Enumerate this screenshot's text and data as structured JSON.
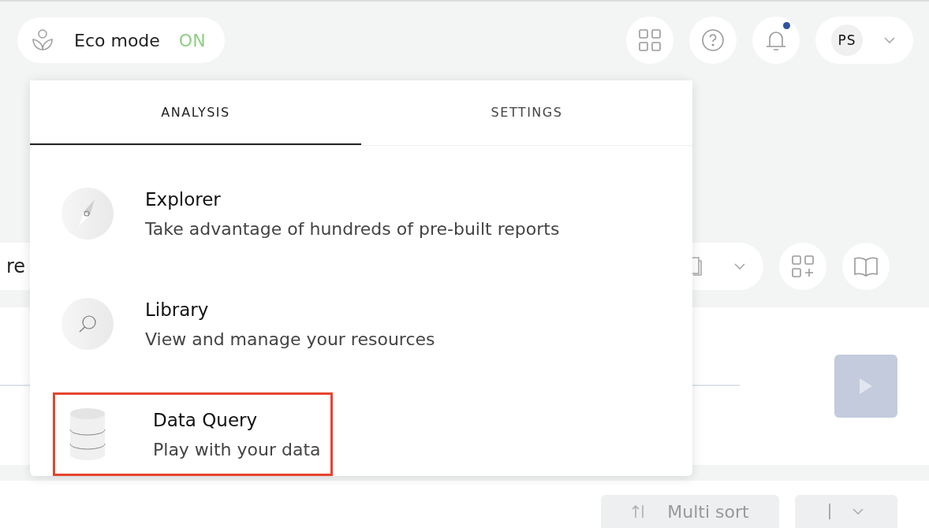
{
  "header": {
    "eco_mode": {
      "label": "Eco mode",
      "status": "ON",
      "on": true
    },
    "notifications": {
      "unread": true
    },
    "user": {
      "initials": "PS"
    }
  },
  "toolbar": {
    "field_text": "re"
  },
  "bottom_bar": {
    "multi_sort": "Multi sort"
  },
  "menu": {
    "tabs": [
      {
        "label": "ANALYSIS",
        "selected": true
      },
      {
        "label": "SETTINGS",
        "selected": false
      }
    ],
    "items": [
      {
        "kind": "compass",
        "title": "Explorer",
        "description": "Take advantage of hundreds of pre-built reports",
        "highlighted": false
      },
      {
        "kind": "search",
        "title": "Library",
        "description": "View and manage your resources",
        "highlighted": false
      },
      {
        "kind": "database",
        "title": "Data Query",
        "description": "Play with your data",
        "highlighted": true
      }
    ]
  }
}
